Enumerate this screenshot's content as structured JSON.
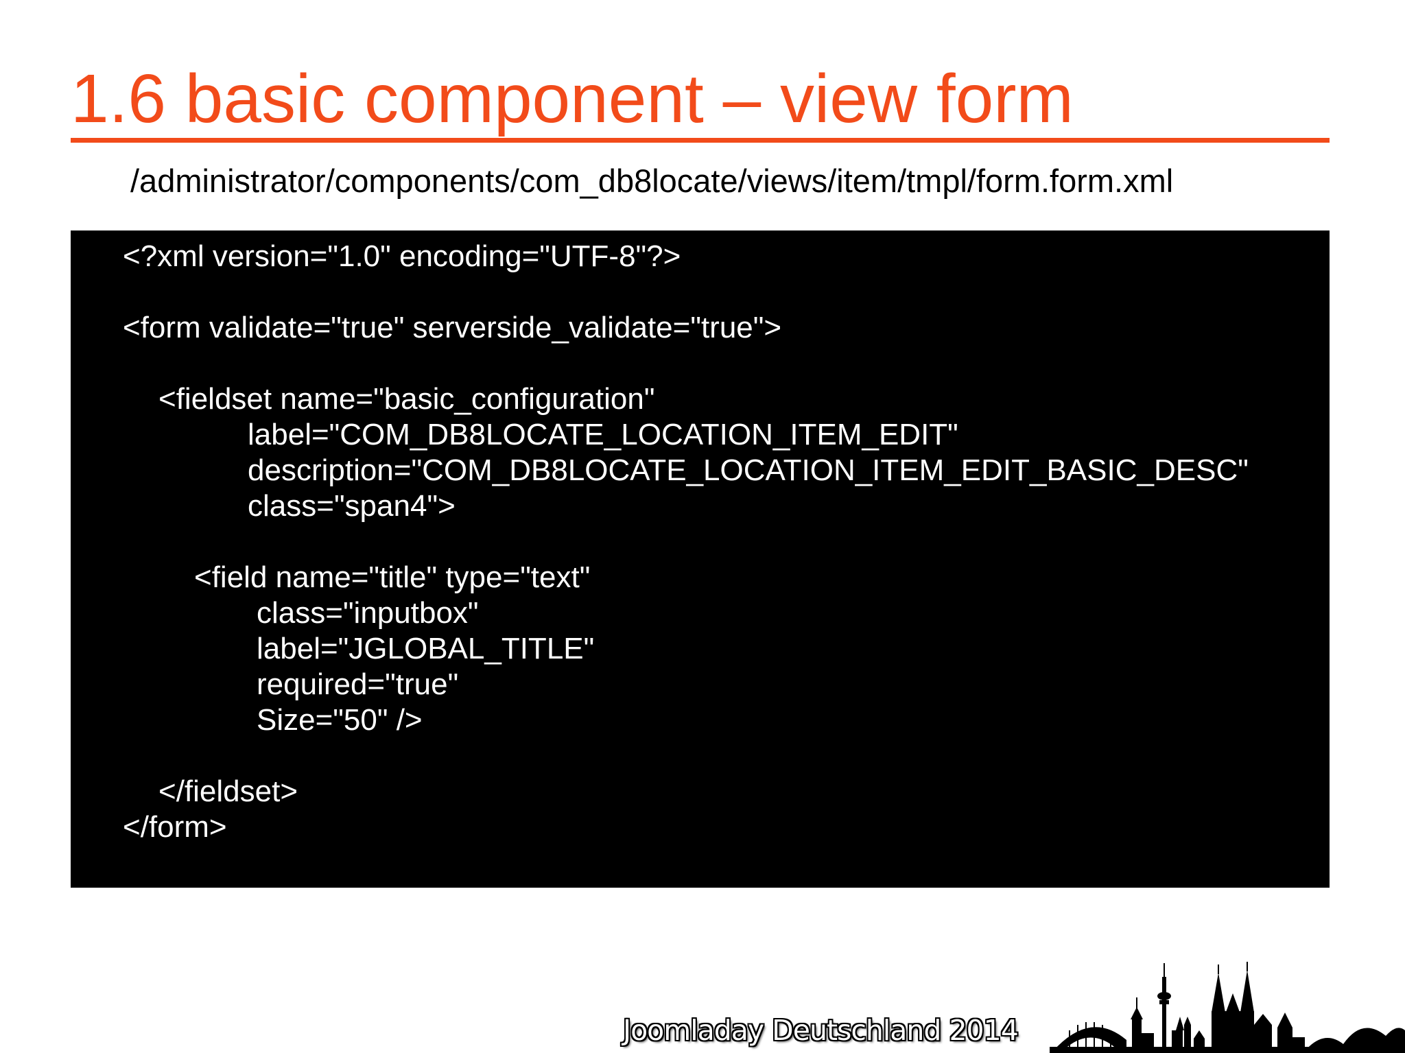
{
  "slide": {
    "title": "1.6 basic component – view form",
    "path": "/administrator/components/com_db8locate/views/item/tmpl/form.form.xml",
    "code": {
      "lines": [
        "<?xml version=\"1.0\" encoding=\"UTF-8\"?>",
        "",
        "<form validate=\"true\" serverside_validate=\"true\">",
        "",
        "<fieldset name=\"basic_configuration\"",
        "label=\"COM_DB8LOCATE_LOCATION_ITEM_EDIT\"",
        "description=\"COM_DB8LOCATE_LOCATION_ITEM_EDIT_BASIC_DESC\"",
        "class=\"span4\">",
        "",
        "<field name=\"title\" type=\"text\"",
        "class=\"inputbox\"",
        "label=\"JGLOBAL_TITLE\"",
        "required=\"true\"",
        "Size=\"50\" />",
        "",
        "</fieldset>",
        "</form>"
      ]
    },
    "footer": {
      "text": "Joomladay Deutschland 2014",
      "logo_icon": "cologne-skyline-icon"
    },
    "colors": {
      "accent": "#f24b1a",
      "code_background": "#000000",
      "code_text": "#ffffff"
    }
  }
}
